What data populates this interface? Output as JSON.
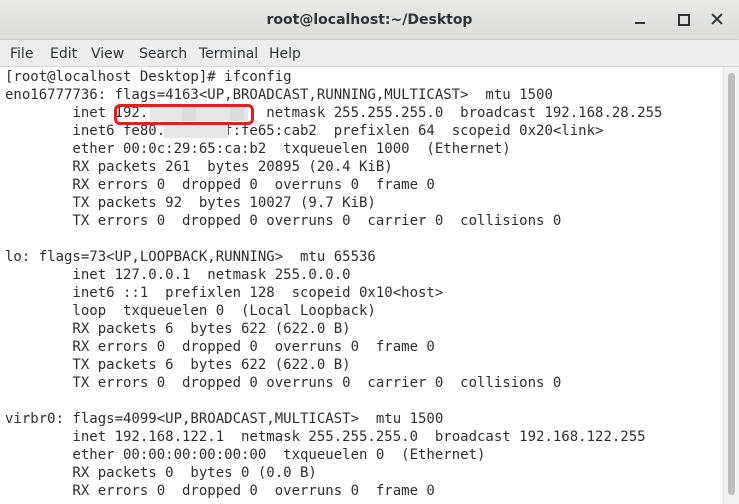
{
  "window": {
    "title": "root@localhost:~/Desktop"
  },
  "menu": {
    "file": "File",
    "edit": "Edit",
    "view": "View",
    "search": "Search",
    "terminal": "Terminal",
    "help": "Help"
  },
  "terminal": {
    "lines": [
      "[root@localhost Desktop]# ifconfig",
      "eno16777736: flags=4163<UP,BROADCAST,RUNNING,MULTICAST>  mtu 1500",
      "        inet 192.              netmask 255.255.255.0  broadcast 192.168.28.255",
      "        inet6 fe80.. 20c. f:fe65:cab2  prefixlen 64  scopeid 0x20<link>",
      "        ether 00:0c:29:65:ca:b2  txqueuelen 1000  (Ethernet)",
      "        RX packets 261  bytes 20895 (20.4 KiB)",
      "        RX errors 0  dropped 0  overruns 0  frame 0",
      "        TX packets 92  bytes 10027 (9.7 KiB)",
      "        TX errors 0  dropped 0 overruns 0  carrier 0  collisions 0",
      "",
      "lo: flags=73<UP,LOOPBACK,RUNNING>  mtu 65536",
      "        inet 127.0.0.1  netmask 255.0.0.0",
      "        inet6 ::1  prefixlen 128  scopeid 0x10<host>",
      "        loop  txqueuelen 0  (Local Loopback)",
      "        RX packets 6  bytes 622 (622.0 B)",
      "        RX errors 0  dropped 0  overruns 0  frame 0",
      "        TX packets 6  bytes 622 (622.0 B)",
      "        TX errors 0  dropped 0 overruns 0  carrier 0  collisions 0",
      "",
      "virbr0: flags=4099<UP,BROADCAST,MULTICAST>  mtu 1500",
      "        inet 192.168.122.1  netmask 255.255.255.0  broadcast 192.168.122.255",
      "        ether 00:00:00:00:00:00  txqueuelen 0  (Ethernet)",
      "        RX packets 0  bytes 0 (0.0 B)",
      "        RX errors 0  dropped 0  overruns 0  frame 0"
    ]
  },
  "colors": {
    "highlight": "#e0201a",
    "terminal_text": "#2e2e2e",
    "terminal_bg": "#ffffff"
  }
}
